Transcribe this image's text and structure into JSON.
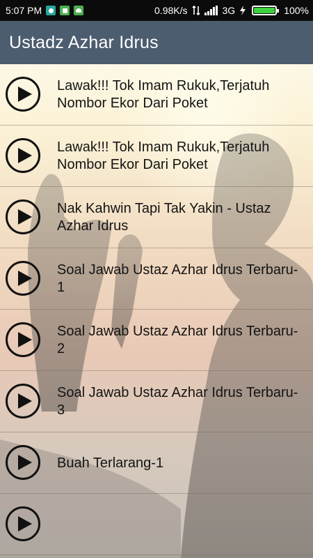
{
  "status_bar": {
    "time": "5:07 PM",
    "speed": "0.98K/s",
    "network": "3G",
    "battery": "100%",
    "battery_level": 1.0,
    "icons": [
      "shield-notification-icon",
      "sim-notification-icon",
      "android-notification-icon",
      "data-transfer-icon",
      "signal-icon",
      "charging-icon",
      "battery-icon"
    ]
  },
  "action_bar": {
    "title": "Ustadz Azhar Idrus"
  },
  "list": {
    "items": [
      {
        "title": "Lawak!!! Tok Imam Rukuk,Terjatuh Nombor Ekor Dari Poket",
        "icon": "play-icon"
      },
      {
        "title": "Lawak!!! Tok Imam Rukuk,Terjatuh Nombor Ekor Dari Poket",
        "icon": "play-icon"
      },
      {
        "title": "Nak Kahwin Tapi Tak Yakin - Ustaz Azhar Idrus",
        "icon": "play-icon"
      },
      {
        "title": "Soal Jawab Ustaz Azhar Idrus Terbaru-1",
        "icon": "play-icon"
      },
      {
        "title": "Soal Jawab Ustaz Azhar Idrus Terbaru-2",
        "icon": "play-icon"
      },
      {
        "title": "Soal Jawab Ustaz Azhar Idrus Terbaru-3",
        "icon": "play-icon"
      },
      {
        "title": "Buah Terlarang-1",
        "icon": "play-icon"
      },
      {
        "title": "",
        "icon": "play-icon"
      }
    ]
  },
  "colors": {
    "status_bar": "#0b0b0b",
    "action_bar": "#4c5d70",
    "text": "#141414",
    "battery_fill": "#3dd23d"
  }
}
